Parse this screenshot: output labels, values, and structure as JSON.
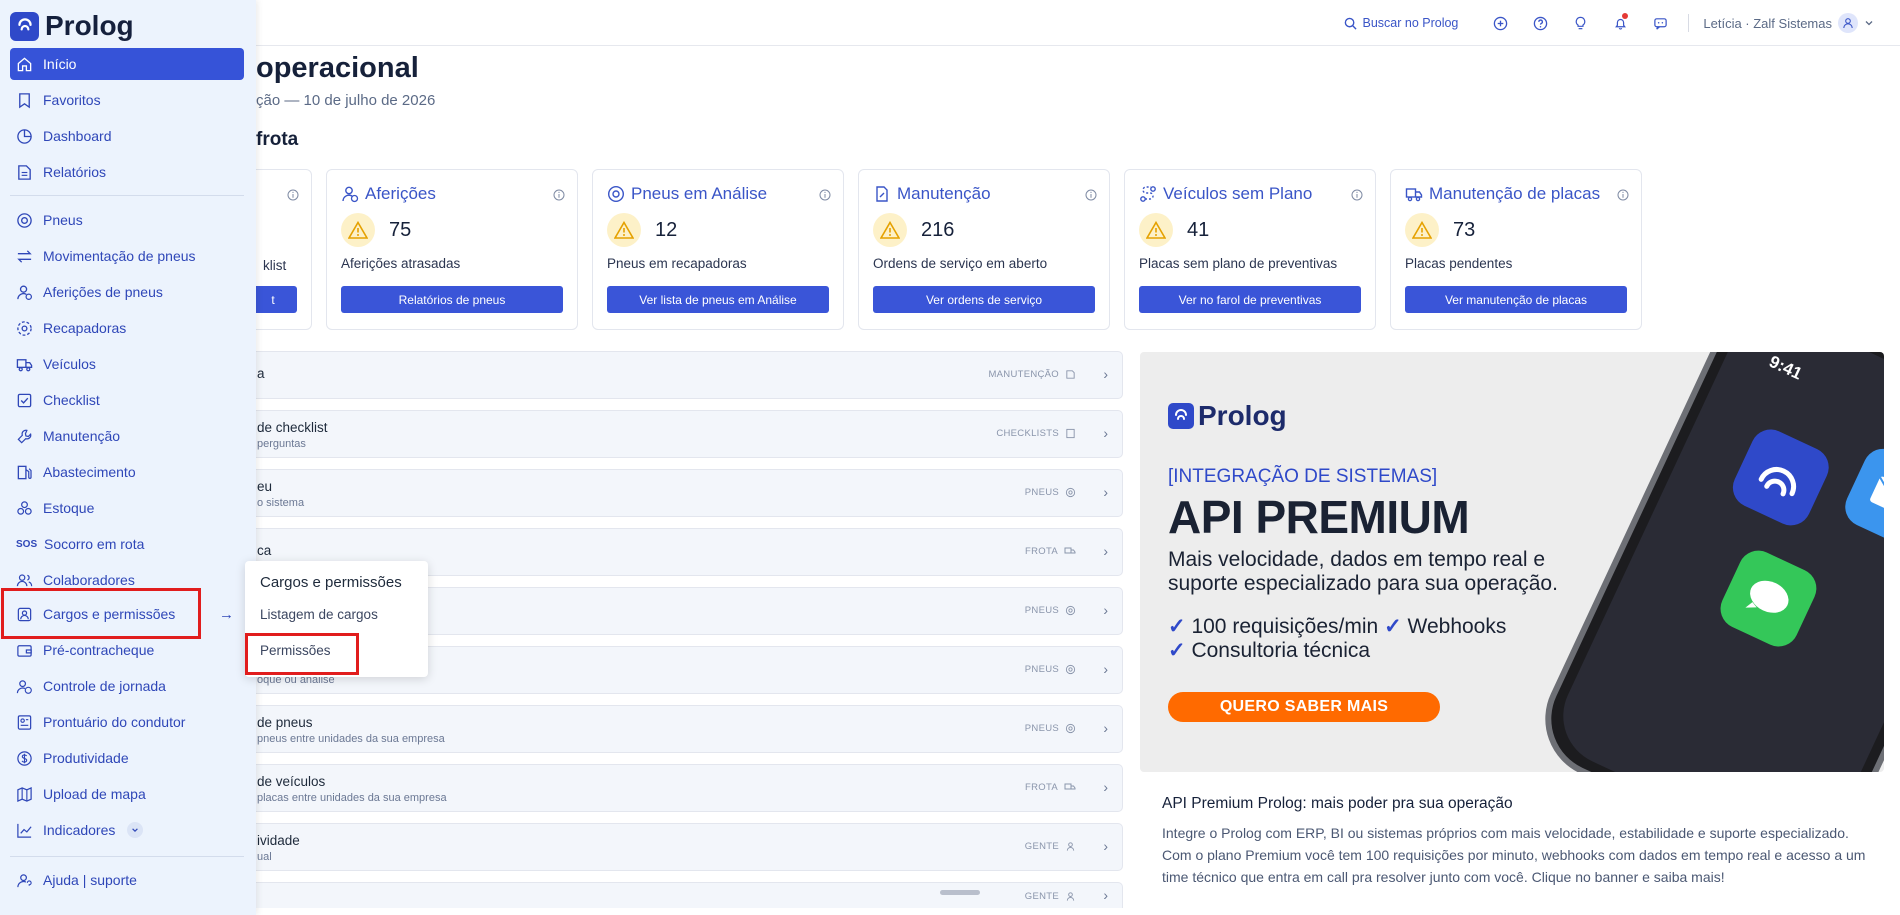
{
  "topbar": {
    "search_label": "Buscar no Prolog",
    "user": "Letícia · Zalf Sistemas"
  },
  "header": {
    "title": "operacional",
    "subtitle": "ção — 10 de julho de 2026",
    "section": "frota"
  },
  "cards": [
    {
      "title": "",
      "value": "",
      "desc": "klist",
      "button": "t"
    },
    {
      "title": "Aferições",
      "value": "75",
      "desc": "Aferições atrasadas",
      "button": "Relatórios de pneus"
    },
    {
      "title": "Pneus em Análise",
      "value": "12",
      "desc": "Pneus em recapadoras",
      "button": "Ver lista de pneus em Análise"
    },
    {
      "title": "Manutenção",
      "value": "216",
      "desc": "Ordens de serviço em aberto",
      "button": "Ver ordens de serviço"
    },
    {
      "title": "Veículos sem Plano",
      "value": "41",
      "desc": "Placas sem plano de preventivas",
      "button": "Ver no farol de preventivas"
    },
    {
      "title": "Manutenção de placas",
      "value": "73",
      "desc": "Placas pendentes",
      "button": "Ver manutenção de placas"
    }
  ],
  "list": [
    {
      "title": "a",
      "sub": "",
      "tag": "MANUTENÇÃO"
    },
    {
      "title": "de checklist",
      "sub": "perguntas",
      "tag": "CHECKLISTS"
    },
    {
      "title": "eu",
      "sub": "o sistema",
      "tag": "PNEUS"
    },
    {
      "title": "ca",
      "sub": "",
      "tag": "FROTA"
    },
    {
      "title": "",
      "sub": "",
      "tag": "PNEUS"
    },
    {
      "title": "",
      "sub": "oque ou análise",
      "tag": "PNEUS"
    },
    {
      "title": "de pneus",
      "sub": "pneus entre unidades da sua empresa",
      "tag": "PNEUS"
    },
    {
      "title": "de veículos",
      "sub": "placas entre unidades da sua empresa",
      "tag": "FROTA"
    },
    {
      "title": "ividade",
      "sub": "ual",
      "tag": "GENTE"
    },
    {
      "title": "",
      "sub": "",
      "tag": "GENTE"
    }
  ],
  "banner": {
    "logo": "Prolog",
    "tag": "[INTEGRAÇÃO DE SISTEMAS]",
    "title": "API PREMIUM",
    "line1": "Mais velocidade, dados em tempo real e",
    "line2": "suporte especializado para sua operação.",
    "check_mark": "✓",
    "feature1": "100 requisições/min",
    "feature2": "Webhooks",
    "feature3": "Consultoria técnica",
    "cta": "QUERO SABER MAIS",
    "phone_time": "9:41",
    "heading": "API Premium Prolog: mais poder pra sua operação",
    "body": "Integre o Prolog com ERP, BI ou sistemas próprios com mais velocidade, estabilidade e suporte especializado. Com o plano Premium você tem 100 requisições por minuto, webhooks com dados em tempo real e acesso a um time técnico que entra em call pra resolver junto com você. Clique no banner e saiba mais!"
  },
  "sidebar": {
    "logo": "Prolog",
    "items": [
      {
        "label": "Início",
        "icon": "home-icon"
      },
      {
        "label": "Favoritos",
        "icon": "bookmark-icon"
      },
      {
        "label": "Dashboard",
        "icon": "pie-chart-icon"
      },
      {
        "label": "Relatórios",
        "icon": "reports-icon"
      },
      {
        "label": "Pneus",
        "icon": "tire-icon"
      },
      {
        "label": "Movimentação de pneus",
        "icon": "transfer-icon"
      },
      {
        "label": "Aferições de pneus",
        "icon": "gauge-icon"
      },
      {
        "label": "Recapadoras",
        "icon": "retread-icon"
      },
      {
        "label": "Veículos",
        "icon": "truck-icon"
      },
      {
        "label": "Checklist",
        "icon": "checklist-icon"
      },
      {
        "label": "Manutenção",
        "icon": "wrench-icon"
      },
      {
        "label": "Abastecimento",
        "icon": "fuel-icon"
      },
      {
        "label": "Estoque",
        "icon": "boxes-icon"
      },
      {
        "label": "Socorro em rota",
        "icon": "sos-icon"
      },
      {
        "label": "Colaboradores",
        "icon": "users-icon"
      },
      {
        "label": "Cargos e permissões",
        "icon": "badge-icon"
      },
      {
        "label": "Pré-contracheque",
        "icon": "wallet-icon"
      },
      {
        "label": "Controle de jornada",
        "icon": "clock-user-icon"
      },
      {
        "label": "Prontuário do condutor",
        "icon": "id-card-icon"
      },
      {
        "label": "Produtividade",
        "icon": "dollar-icon"
      },
      {
        "label": "Upload de mapa",
        "icon": "map-icon"
      },
      {
        "label": "Indicadores",
        "icon": "chart-line-icon"
      },
      {
        "label": "Ajuda | suporte",
        "icon": "support-icon"
      }
    ],
    "sos_text": "SOS",
    "arrow": "→"
  },
  "submenu": {
    "title": "Cargos e permissões",
    "items": [
      "Listagem de cargos",
      "Permissões"
    ]
  }
}
